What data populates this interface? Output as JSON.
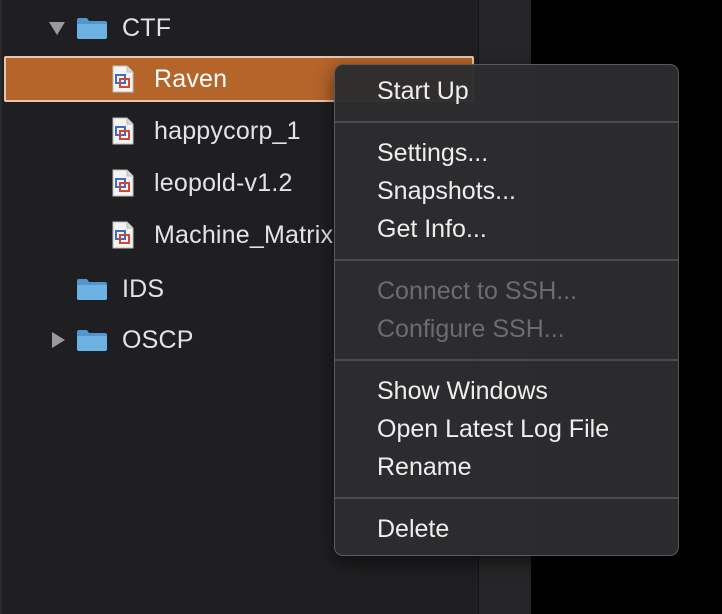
{
  "sidebar": {
    "tree": [
      {
        "type": "folder",
        "label": "CTF",
        "expanded": true
      },
      {
        "type": "vm",
        "label": "Raven",
        "selected": true
      },
      {
        "type": "vm",
        "label": "happycorp_1"
      },
      {
        "type": "vm",
        "label": "leopold-v1.2"
      },
      {
        "type": "vm",
        "label": "Machine_Matrix"
      },
      {
        "type": "folder",
        "label": "IDS"
      },
      {
        "type": "folder",
        "label": "OSCP",
        "expanded": false
      }
    ]
  },
  "context_menu": {
    "groups": [
      [
        {
          "label": "Start Up",
          "enabled": true
        }
      ],
      [
        {
          "label": "Settings...",
          "enabled": true
        },
        {
          "label": "Snapshots...",
          "enabled": true
        },
        {
          "label": "Get Info...",
          "enabled": true
        }
      ],
      [
        {
          "label": "Connect to SSH...",
          "enabled": false
        },
        {
          "label": "Configure SSH...",
          "enabled": false
        }
      ],
      [
        {
          "label": "Show Windows",
          "enabled": true
        },
        {
          "label": "Open Latest Log File",
          "enabled": true
        },
        {
          "label": "Rename",
          "enabled": true
        }
      ],
      [
        {
          "label": "Delete",
          "enabled": true
        }
      ]
    ]
  },
  "colors": {
    "selection": "#b5642a",
    "folder": "#5aa4d6",
    "menu_bg": "#2c2c2e"
  }
}
